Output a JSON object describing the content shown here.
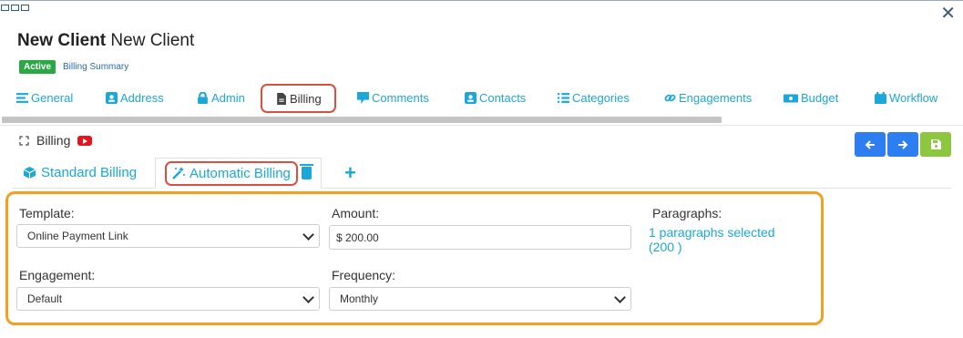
{
  "window": {
    "close_label": "✕"
  },
  "header": {
    "title_bold": "New Client",
    "title_rest": "New Client",
    "status_badge": "Active",
    "summary_link": "Billing Summary"
  },
  "nav": {
    "items": [
      {
        "label": "General",
        "icon": "list-icon"
      },
      {
        "label": "Address",
        "icon": "address-card-icon"
      },
      {
        "label": "Admin",
        "icon": "lock-icon"
      },
      {
        "label": "Billing",
        "icon": "document-icon"
      },
      {
        "label": "Comments",
        "icon": "comment-icon"
      },
      {
        "label": "Contacts",
        "icon": "contact-card-icon"
      },
      {
        "label": "Categories",
        "icon": "list-bullets-icon"
      },
      {
        "label": "Engagements",
        "icon": "link-icon"
      },
      {
        "label": "Budget",
        "icon": "money-icon"
      },
      {
        "label": "Workflow",
        "icon": "calendar-icon"
      }
    ],
    "active": "Billing"
  },
  "section": {
    "title": "Billing"
  },
  "subtabs": {
    "standard": "Standard Billing",
    "automatic": "Automatic Billing",
    "add": "+"
  },
  "form": {
    "template": {
      "label": "Template:",
      "value": "Online Payment Link"
    },
    "amount": {
      "label": "Amount:",
      "value": "$ 200.00"
    },
    "paragraphs": {
      "label": "Paragraphs:",
      "link_line1": "1 paragraphs selected",
      "link_line2": "(200 )"
    },
    "engagement": {
      "label": "Engagement:",
      "value": "Default"
    },
    "frequency": {
      "label": "Frequency:",
      "value": "Monthly"
    }
  },
  "colors": {
    "accent": "#1ba8d8",
    "highlight_red": "#d9503f",
    "highlight_orange": "#f0a122",
    "active_badge": "#2ca745",
    "nav_button_blue": "#2d7ef0",
    "save_button_green": "#8dc63f"
  }
}
